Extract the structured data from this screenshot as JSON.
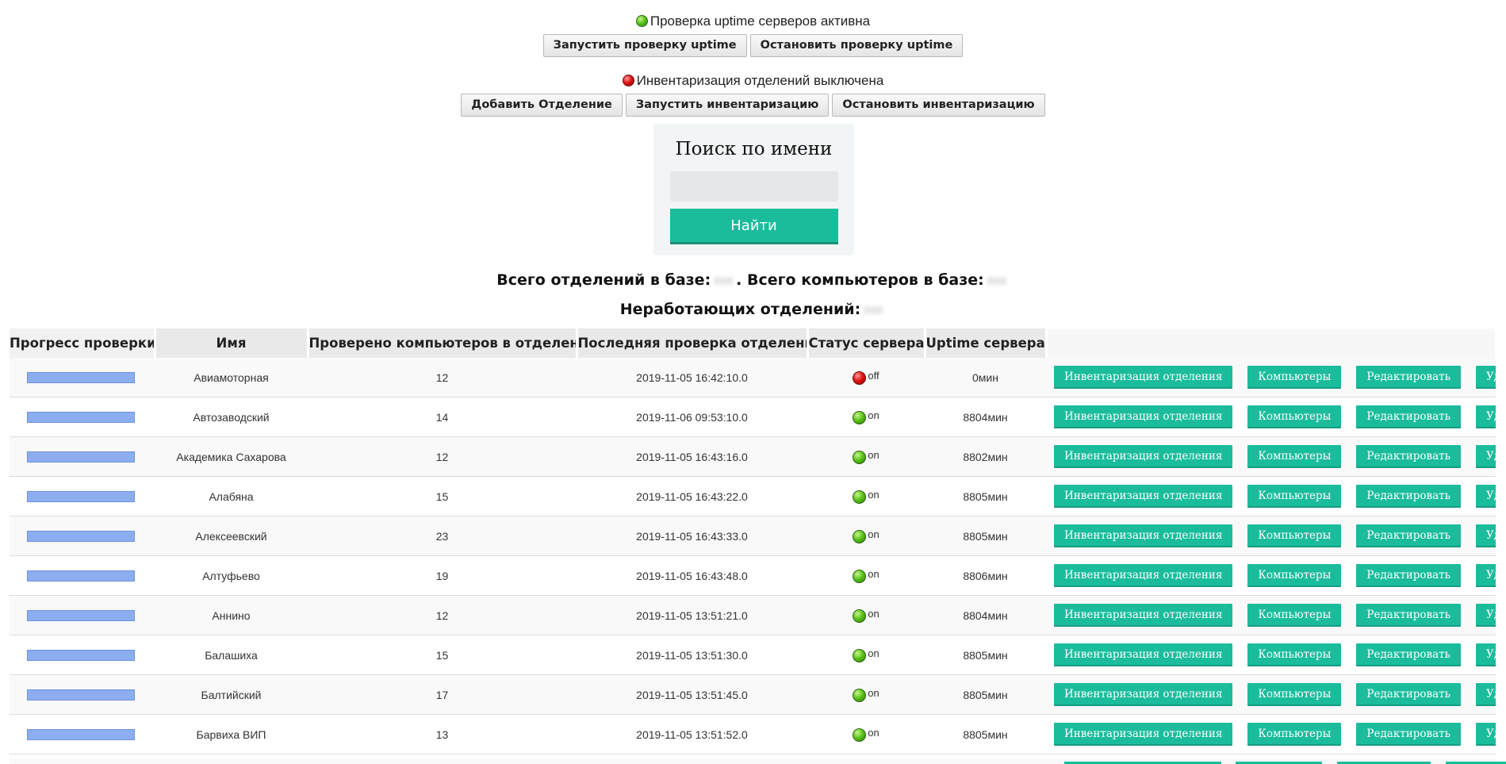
{
  "uptime": {
    "status_text": "Проверка uptime серверов активна",
    "status_color": "green",
    "start_label": "Запустить проверку uptime",
    "stop_label": "Остановить проверку uptime"
  },
  "inventory": {
    "status_text": "Инвентаризация отделений выключена",
    "status_color": "red",
    "add_label": "Добавить Отделение",
    "start_label": "Запустить инвентаризацию",
    "stop_label": "Остановить инвентаризацию"
  },
  "search": {
    "title": "Поиск по имени",
    "value": "",
    "button_label": "Найти"
  },
  "totals": {
    "departments_label": "Всего отделений в базе:",
    "computers_label": ". Всего компьютеров в базе:",
    "down_label": "Неработающих отделений:"
  },
  "table": {
    "headers": [
      "Прогресс проверки",
      "Имя",
      "Проверено компьютеров в отделении",
      "Последняя проверка отделения",
      "Статус сервера",
      "Uptime сервера"
    ],
    "action_labels": {
      "inventory": "Инвентаризация отделения",
      "computers": "Компьютеры",
      "edit": "Редактировать",
      "delete": "Удалить"
    },
    "rows": [
      {
        "progress": 1.0,
        "name": "Авиамоторная",
        "checked": "12",
        "last_check": "2019-11-05 16:42:10.0",
        "status": "off",
        "uptime": "0мин"
      },
      {
        "progress": 1.0,
        "name": "Автозаводский",
        "checked": "14",
        "last_check": "2019-11-06 09:53:10.0",
        "status": "on",
        "uptime": "8804мин"
      },
      {
        "progress": 1.0,
        "name": "Академика Сахарова",
        "checked": "12",
        "last_check": "2019-11-05 16:43:16.0",
        "status": "on",
        "uptime": "8802мин"
      },
      {
        "progress": 1.0,
        "name": "Алабяна",
        "checked": "15",
        "last_check": "2019-11-05 16:43:22.0",
        "status": "on",
        "uptime": "8805мин"
      },
      {
        "progress": 1.0,
        "name": "Алексеевский",
        "checked": "23",
        "last_check": "2019-11-05 16:43:33.0",
        "status": "on",
        "uptime": "8805мин"
      },
      {
        "progress": 1.0,
        "name": "Алтуфьево",
        "checked": "19",
        "last_check": "2019-11-05 16:43:48.0",
        "status": "on",
        "uptime": "8806мин"
      },
      {
        "progress": 1.0,
        "name": "Аннино",
        "checked": "12",
        "last_check": "2019-11-05 13:51:21.0",
        "status": "on",
        "uptime": "8804мин"
      },
      {
        "progress": 1.0,
        "name": "Балашиха",
        "checked": "15",
        "last_check": "2019-11-05 13:51:30.0",
        "status": "on",
        "uptime": "8805мин"
      },
      {
        "progress": 1.0,
        "name": "Балтийский",
        "checked": "17",
        "last_check": "2019-11-05 13:51:45.0",
        "status": "on",
        "uptime": "8805мин"
      },
      {
        "progress": 1.0,
        "name": "Барвиха ВИП",
        "checked": "13",
        "last_check": "2019-11-05 13:51:52.0",
        "status": "on",
        "uptime": "8805мин"
      }
    ]
  },
  "colors": {
    "accent": "#1abc9c",
    "progress_fill": "#8caef0",
    "on": "#5cc51c",
    "off": "#e01515"
  }
}
